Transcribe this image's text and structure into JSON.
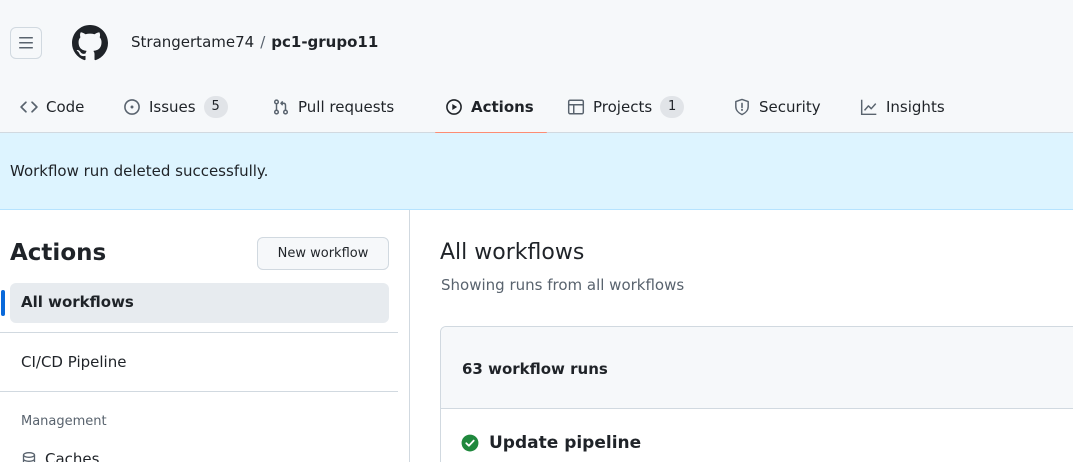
{
  "repo": {
    "owner": "Strangertame74",
    "separator": "/",
    "name": "pc1-grupo11"
  },
  "tabs": [
    {
      "label": "Code",
      "icon": "code-icon"
    },
    {
      "label": "Issues",
      "icon": "issue-opened-icon",
      "count": "5"
    },
    {
      "label": "Pull requests",
      "icon": "git-pull-request-icon"
    },
    {
      "label": "Actions",
      "icon": "play-icon",
      "selected": true
    },
    {
      "label": "Projects",
      "icon": "table-icon",
      "count": "1"
    },
    {
      "label": "Security",
      "icon": "shield-icon"
    },
    {
      "label": "Insights",
      "icon": "graph-icon"
    }
  ],
  "flash": {
    "message": "Workflow run deleted successfully."
  },
  "sidebar": {
    "title": "Actions",
    "new_workflow_label": "New workflow",
    "items": [
      {
        "label": "All workflows",
        "selected": true
      },
      {
        "label": "CI/CD Pipeline"
      }
    ],
    "management_label": "Management",
    "caches_label": "Caches"
  },
  "main": {
    "title": "All workflows",
    "subtitle": "Showing runs from all workflows",
    "runs_count": "63 workflow runs",
    "runs": [
      {
        "title": "Update pipeline",
        "status": "success"
      }
    ]
  },
  "colors": {
    "accent": "#0969da",
    "tab_underline": "#fd8c73",
    "flash_bg": "#ddf4ff",
    "success": "#1f883d"
  }
}
